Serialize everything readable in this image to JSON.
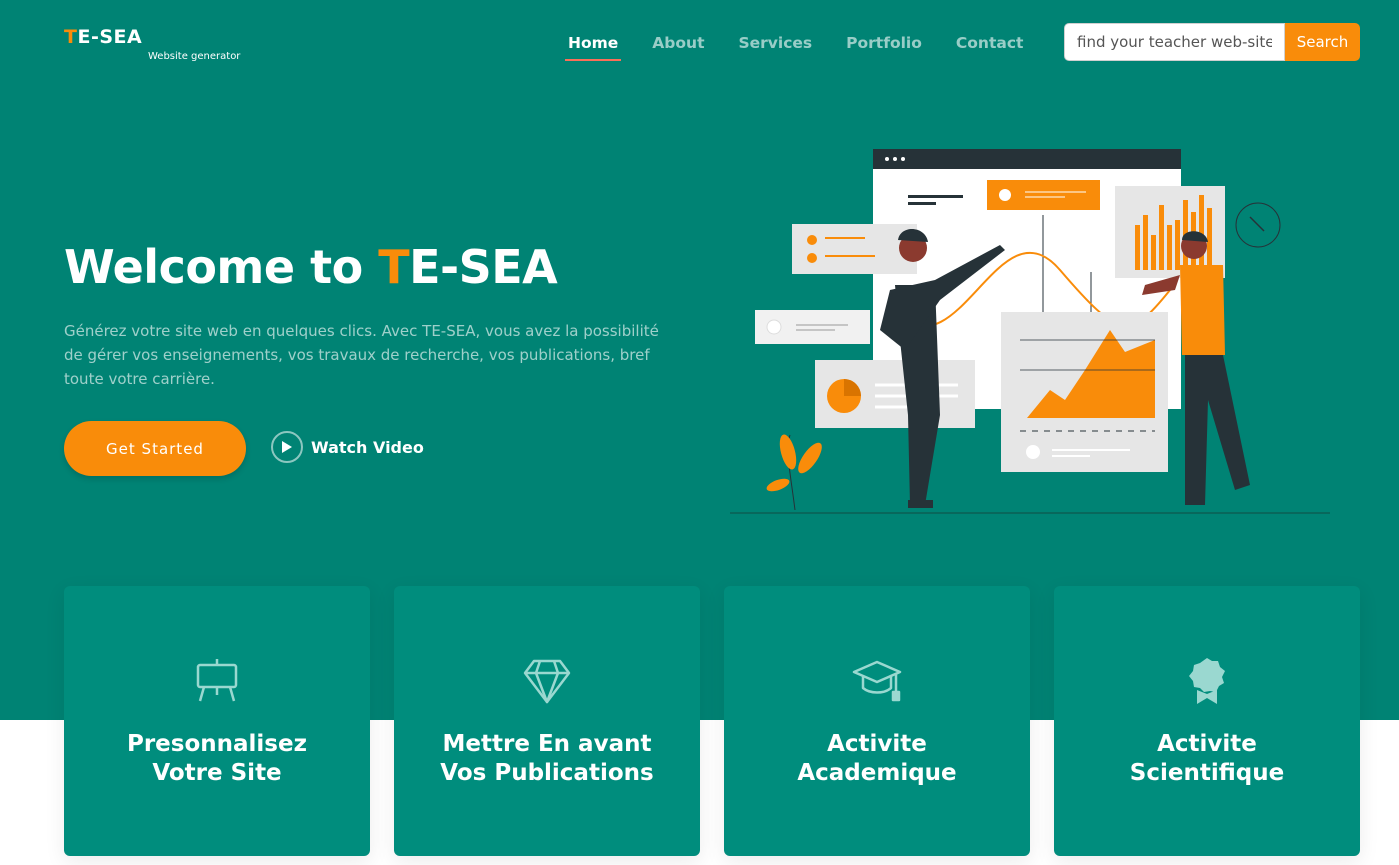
{
  "header": {
    "logo": {
      "prefix": "T",
      "rest": "E-SEA",
      "subtitle": "Website generator"
    },
    "nav": [
      {
        "label": "Home",
        "active": true
      },
      {
        "label": "About",
        "active": false
      },
      {
        "label": "Services",
        "active": false
      },
      {
        "label": "Portfolio",
        "active": false
      },
      {
        "label": "Contact",
        "active": false
      }
    ],
    "search": {
      "value": "find your teacher web-site",
      "button_label": "Search"
    }
  },
  "hero": {
    "title_prefix": "Welcome to ",
    "title_accent": "T",
    "title_rest": "E-SEA",
    "description": "Générez votre site web en quelques clics. Avec TE-SEA, vous avez la possibilité de gérer vos enseignements, vos travaux de recherche, vos publications, bref toute votre carrière.",
    "cta_label": "Get Started",
    "watch_label": "Watch Video"
  },
  "cards": [
    {
      "title": "Presonnalisez Votre Site",
      "icon": "easel-icon"
    },
    {
      "title": "Mettre En avant Vos Publications",
      "icon": "gem-icon"
    },
    {
      "title": "Activite Academique",
      "icon": "mortarboard-icon"
    },
    {
      "title": "Activite Scientifique",
      "icon": "award-icon"
    }
  ],
  "colors": {
    "primary": "#008374",
    "card": "#008d7d",
    "accent": "#f98c0a",
    "active_underline": "#f96f59"
  }
}
